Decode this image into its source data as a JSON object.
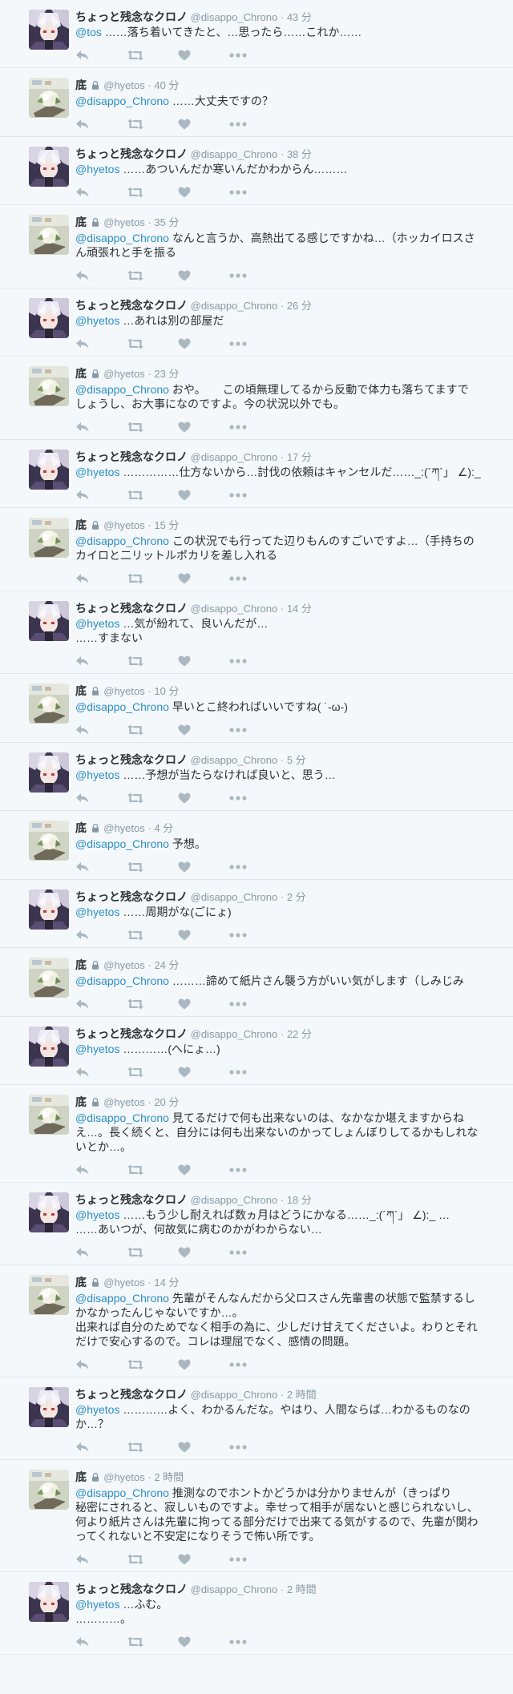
{
  "users": {
    "chrono": {
      "name": "ちょっと残念なクロノ",
      "handle": "@disappo_Chrono",
      "avatar": "chrono-avatar-icon"
    },
    "hyetos": {
      "name": "底",
      "handle": "@hyetos",
      "avatar": "hyetos-avatar-icon",
      "protected": true
    }
  },
  "colors": {
    "mention": "#2a8fc7",
    "meta": "#8899a6",
    "text": "#292f33",
    "background": "#f5f8fa",
    "divider": "#e1e8ed",
    "action_icon": "#aab8c2"
  },
  "tweets": [
    {
      "user": "chrono",
      "name": "ちょっと残念なクロノ",
      "handle": "@disappo_Chrono",
      "time": "43 分",
      "lines": [
        {
          "mention": "@tos",
          "text": " ……落ち着いてきたと、…思ったら……これか……"
        }
      ]
    },
    {
      "user": "hyetos",
      "name": "底",
      "handle": "@hyetos",
      "time": "40 分",
      "lines": [
        {
          "mention": "@disappo_Chrono",
          "text": " ……大丈夫ですの？"
        }
      ]
    },
    {
      "user": "chrono",
      "name": "ちょっと残念なクロノ",
      "handle": "@disappo_Chrono",
      "time": "38 分",
      "lines": [
        {
          "mention": "@hyetos",
          "text": " ……あついんだか寒いんだかわからん………"
        }
      ]
    },
    {
      "user": "hyetos",
      "name": "底",
      "handle": "@hyetos",
      "time": "35 分",
      "lines": [
        {
          "mention": "@disappo_Chrono",
          "text": " なんと言うか、高熱出てる感じですかね…（ホッカイロスさ"
        },
        {
          "mention": "",
          "text": "ん頑張れと手を振る"
        }
      ]
    },
    {
      "user": "chrono",
      "name": "ちょっと残念なクロノ",
      "handle": "@disappo_Chrono",
      "time": "26 分",
      "lines": [
        {
          "mention": "@hyetos",
          "text": " …あれは別の部屋だ"
        }
      ]
    },
    {
      "user": "hyetos",
      "name": "底",
      "handle": "@hyetos",
      "time": "23 分",
      "lines": [
        {
          "mention": "@disappo_Chrono",
          "text": " おや。　　この頃無理してるから反動で体力も落ちてますで"
        },
        {
          "mention": "",
          "text": "しょうし、お大事になのですよ。今の状況以外でも。"
        }
      ]
    },
    {
      "user": "chrono",
      "name": "ちょっと残念なクロノ",
      "handle": "@disappo_Chrono",
      "time": "17 分",
      "lines": [
        {
          "mention": "@hyetos",
          "text": " ……………仕方ないから…討伐の依頼はキャンセルだ……_:(´ཀ`」 ∠):_"
        }
      ]
    },
    {
      "user": "hyetos",
      "name": "底",
      "handle": "@hyetos",
      "time": "15 分",
      "lines": [
        {
          "mention": "@disappo_Chrono",
          "text": " この状況でも行ってた辺りもんのすごいですよ…（手持ちの"
        },
        {
          "mention": "",
          "text": "カイロと二リットルポカリを差し入れる"
        }
      ]
    },
    {
      "user": "chrono",
      "name": "ちょっと残念なクロノ",
      "handle": "@disappo_Chrono",
      "time": "14 分",
      "lines": [
        {
          "mention": "@hyetos",
          "text": " …気が紛れて、良いんだが…"
        },
        {
          "mention": "",
          "text": "……すまない"
        }
      ]
    },
    {
      "user": "hyetos",
      "name": "底",
      "handle": "@hyetos",
      "time": "10 分",
      "lines": [
        {
          "mention": "@disappo_Chrono",
          "text": " 早いとこ終わればいいですね( ˙-ω-)"
        }
      ]
    },
    {
      "user": "chrono",
      "name": "ちょっと残念なクロノ",
      "handle": "@disappo_Chrono",
      "time": "5 分",
      "lines": [
        {
          "mention": "@hyetos",
          "text": " ……予想が当たらなければ良いと、思う…"
        }
      ]
    },
    {
      "user": "hyetos",
      "name": "底",
      "handle": "@hyetos",
      "time": "4 分",
      "lines": [
        {
          "mention": "@disappo_Chrono",
          "text": " 予想。"
        }
      ]
    },
    {
      "user": "chrono",
      "name": "ちょっと残念なクロノ",
      "handle": "@disappo_Chrono",
      "time": "2 分",
      "lines": [
        {
          "mention": "@hyetos",
          "text": " ……周期がな(ごにょ)"
        }
      ]
    },
    {
      "user": "hyetos",
      "name": "底",
      "handle": "@hyetos",
      "time": "24 分",
      "lines": [
        {
          "mention": "@disappo_Chrono",
          "text": " ………諦めて紙片さん襲う方がいい気がします（しみじみ"
        }
      ]
    },
    {
      "user": "chrono",
      "name": "ちょっと残念なクロノ",
      "handle": "@disappo_Chrono",
      "time": "22 分",
      "lines": [
        {
          "mention": "@hyetos",
          "text": " …………(へにょ…)"
        }
      ]
    },
    {
      "user": "hyetos",
      "name": "底",
      "handle": "@hyetos",
      "time": "20 分",
      "lines": [
        {
          "mention": "@disappo_Chrono",
          "text": " 見てるだけで何も出来ないのは、なかなか堪えますからね"
        },
        {
          "mention": "",
          "text": "え…。長く続くと、自分には何も出来ないのかってしょんぼりしてるかもしれな"
        },
        {
          "mention": "",
          "text": "いとか…。"
        }
      ]
    },
    {
      "user": "chrono",
      "name": "ちょっと残念なクロノ",
      "handle": "@disappo_Chrono",
      "time": "18 分",
      "lines": [
        {
          "mention": "@hyetos",
          "text": " ……もう少し耐えれば数ヵ月はどうにかなる……_:(´ཀ`」 ∠):_ …"
        },
        {
          "mention": "",
          "text": "……あいつが、何故気に病むのかがわからない…"
        }
      ]
    },
    {
      "user": "hyetos",
      "name": "底",
      "handle": "@hyetos",
      "time": "14 分",
      "lines": [
        {
          "mention": "@disappo_Chrono",
          "text": " 先輩がそんなんだから父ロスさん先輩書の状態で監禁するし"
        },
        {
          "mention": "",
          "text": "かなかったんじゃないですか…。"
        },
        {
          "mention": "",
          "text": "出来れば自分のためでなく相手の為に、少しだけ甘えてくださいよ。わりとそれ"
        },
        {
          "mention": "",
          "text": "だけで安心するので。コレは理屈でなく、感情の問題。"
        }
      ]
    },
    {
      "user": "chrono",
      "name": "ちょっと残念なクロノ",
      "handle": "@disappo_Chrono",
      "time": "2 時間",
      "lines": [
        {
          "mention": "@hyetos",
          "text": " …………よく、わかるんだな。やはり、人間ならば…わかるものなの"
        },
        {
          "mention": "",
          "text": "か…？"
        }
      ]
    },
    {
      "user": "hyetos",
      "name": "底",
      "handle": "@hyetos",
      "time": "2 時間",
      "lines": [
        {
          "mention": "@disappo_Chrono",
          "text": " 推測なのでホントかどうかは分かりませんが（きっぱり"
        },
        {
          "mention": "",
          "text": "秘密にされると、寂しいものですよ。幸せって相手が居ないと感じられないし、"
        },
        {
          "mention": "",
          "text": "何より紙片さんは先輩に拘ってる部分だけで出来てる気がするので、先輩が関わ"
        },
        {
          "mention": "",
          "text": "ってくれないと不安定になりそうで怖い所です。"
        }
      ]
    },
    {
      "user": "chrono",
      "name": "ちょっと残念なクロノ",
      "handle": "@disappo_Chrono",
      "time": "2 時間",
      "lines": [
        {
          "mention": "@hyetos",
          "text": " …ふむ。"
        },
        {
          "mention": "",
          "text": "…………。"
        }
      ]
    }
  ]
}
